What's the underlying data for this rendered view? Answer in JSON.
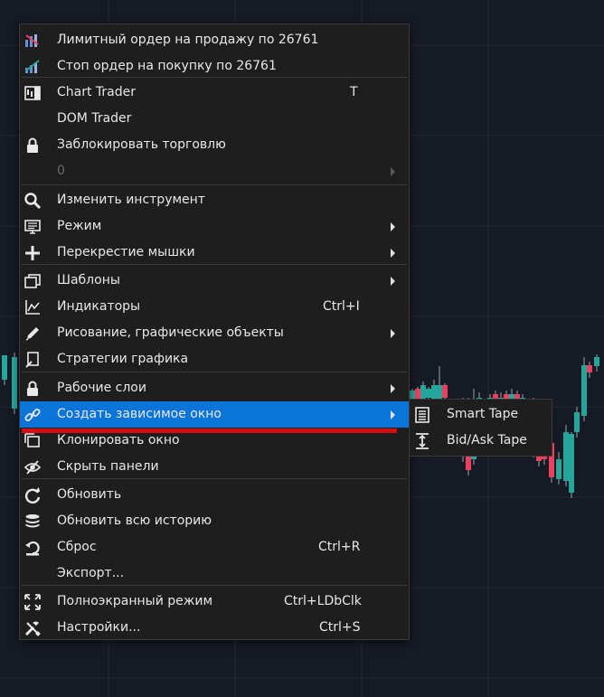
{
  "menu": {
    "items": [
      {
        "label": "Лимитный ордер на продажу по 26761",
        "icon": "limit-sell-icon"
      },
      {
        "label": "Стоп ордер на покупку по 26761",
        "icon": "stop-buy-icon"
      },
      {
        "label": "Chart Trader",
        "shortcut": "T",
        "icon": "chart-trader-icon"
      },
      {
        "label": "DOM Trader",
        "icon": ""
      },
      {
        "label": "Заблокировать торговлю",
        "icon": "lock-icon"
      },
      {
        "label": "0",
        "icon": "",
        "disabled": true,
        "submenu": true
      },
      {
        "label": "Изменить инструмент",
        "icon": "search-icon"
      },
      {
        "label": "Режим",
        "icon": "monitor-icon",
        "submenu": true
      },
      {
        "label": "Перекрестие мышки",
        "icon": "crosshair-icon",
        "submenu": true
      },
      {
        "label": "Шаблоны",
        "icon": "templates-icon",
        "submenu": true
      },
      {
        "label": "Индикаторы",
        "shortcut": "Ctrl+I",
        "icon": "indicators-icon"
      },
      {
        "label": "Рисование, графические объекты",
        "icon": "pencil-icon",
        "submenu": true
      },
      {
        "label": "Стратегии графика",
        "icon": "strategy-icon"
      },
      {
        "label": "Рабочие слои",
        "icon": "lock-icon",
        "submenu": true
      },
      {
        "label": "Создать зависимое окно",
        "icon": "link-icon",
        "submenu": true,
        "highlighted": true
      },
      {
        "label": "Клонировать окно",
        "icon": "clone-icon"
      },
      {
        "label": "Скрыть панели",
        "icon": "eye-off-icon"
      },
      {
        "label": "Обновить",
        "icon": "refresh-icon"
      },
      {
        "label": "Обновить всю историю",
        "icon": "database-icon"
      },
      {
        "label": "Сброс",
        "shortcut": "Ctrl+R",
        "icon": "reset-icon"
      },
      {
        "label": "Экспорт...",
        "icon": ""
      },
      {
        "label": "Полноэкранный режим",
        "shortcut": "Ctrl+LDbClk",
        "icon": "fullscreen-icon"
      },
      {
        "label": "Настройки...",
        "shortcut": "Ctrl+S",
        "icon": "settings-tools-icon"
      }
    ]
  },
  "submenu": {
    "items": [
      {
        "label": "Smart Tape",
        "icon": "document-icon"
      },
      {
        "label": "Bid/Ask Tape",
        "icon": "bid-ask-icon"
      }
    ]
  },
  "colors": {
    "background": "#161a25",
    "menu": "#1e1e1e",
    "highlight": "#0a74d8",
    "bull": "#26a69a",
    "bear": "#ef3e5e",
    "annotation": "#d50f0f"
  }
}
